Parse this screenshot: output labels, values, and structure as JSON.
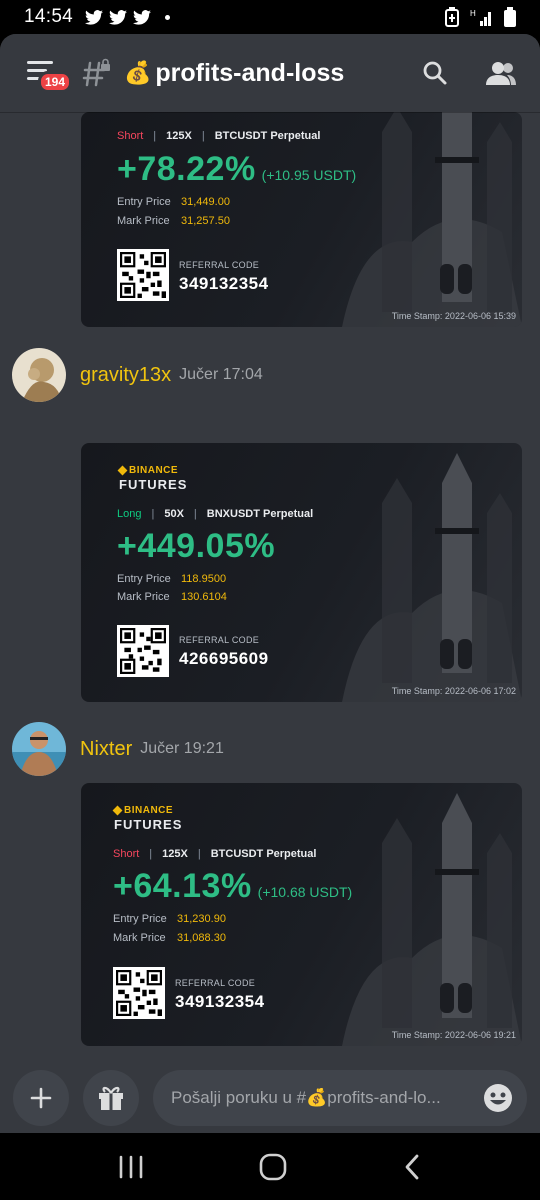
{
  "status": {
    "time": "14:54",
    "notification_icons": [
      "twitter-icon",
      "twitter-icon",
      "twitter-icon"
    ],
    "right_icons": [
      "battery-saver-icon",
      "signal-icon",
      "battery-icon"
    ]
  },
  "header": {
    "badge": "194",
    "channel_emoji": "💰",
    "channel_name": "profits-and-loss"
  },
  "messages": [
    {
      "author": null,
      "card": {
        "side": "Short",
        "leverage": "125X",
        "pair": "BTCUSDT Perpetual",
        "pnl_pct": "+78.22%",
        "pnl_usdt": "(+10.95 USDT)",
        "entry_label": "Entry Price",
        "entry_price": "31,449.00",
        "mark_label": "Mark Price",
        "mark_price": "31,257.50",
        "referral_label": "REFERRAL CODE",
        "referral_code": "349132354",
        "timestamp": "Time Stamp: 2022-06-06 15:39"
      }
    },
    {
      "author": "gravity13x",
      "time": "Jučer 17:04",
      "card": {
        "brand_top": "BINANCE",
        "brand_bottom": "FUTURES",
        "side": "Long",
        "leverage": "50X",
        "pair": "BNXUSDT Perpetual",
        "pnl_pct": "+449.05%",
        "entry_label": "Entry Price",
        "entry_price": "118.9500",
        "mark_label": "Mark Price",
        "mark_price": "130.6104",
        "referral_label": "REFERRAL CODE",
        "referral_code": "426695609",
        "timestamp": "Time Stamp: 2022-06-06 17:02"
      }
    },
    {
      "author": "Nixter",
      "time": "Jučer 19:21",
      "card": {
        "brand_top": "BINANCE",
        "brand_bottom": "FUTURES",
        "side": "Short",
        "leverage": "125X",
        "pair": "BTCUSDT Perpetual",
        "pnl_pct": "+64.13%",
        "pnl_usdt": "(+10.68 USDT)",
        "entry_label": "Entry Price",
        "entry_price": "31,230.90",
        "mark_label": "Mark Price",
        "mark_price": "31,088.30",
        "referral_label": "REFERRAL CODE",
        "referral_code": "349132354",
        "timestamp": "Time Stamp: 2022-06-06 19:21"
      }
    }
  ],
  "input": {
    "placeholder": "Pošalji poruku u #💰profits-and-lo..."
  },
  "colors": {
    "background": "#36393f",
    "author": "#f1c40f",
    "profit": "#2ebd85",
    "short": "#f6465d",
    "long": "#0ecb81",
    "price": "#f0b90b",
    "badge": "#ed4245"
  }
}
